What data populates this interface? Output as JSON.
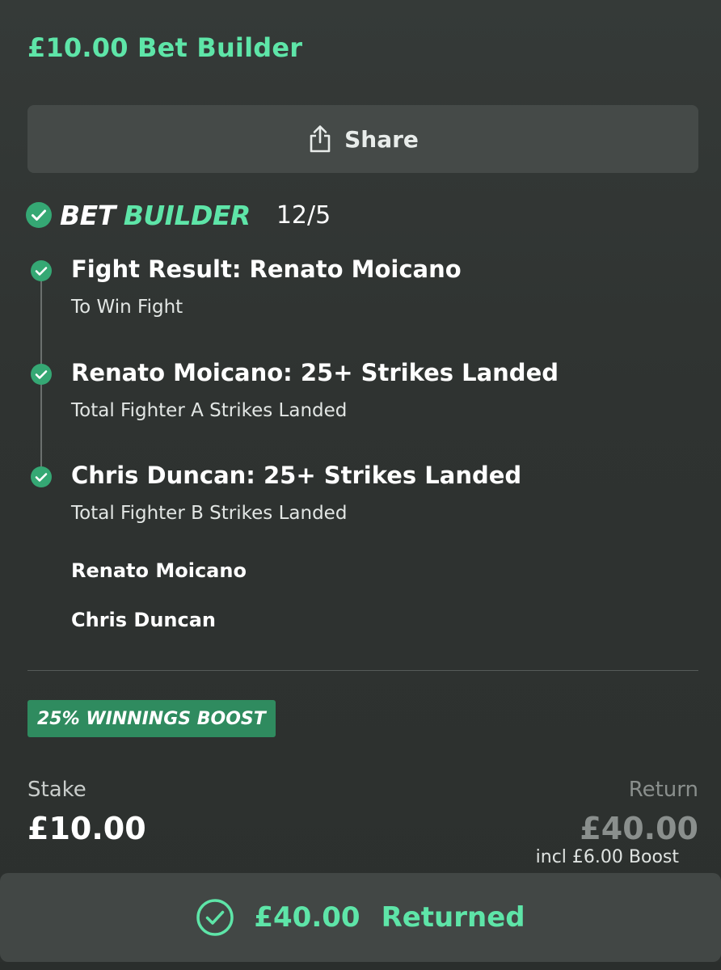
{
  "header": {
    "title": "£10.00 Bet Builder"
  },
  "share": {
    "label": "Share",
    "icon": "share-icon"
  },
  "bet_builder": {
    "word1": "BET",
    "word2": "BUILDER",
    "odds": "12/5",
    "status_icon": "check-circle-icon"
  },
  "selections": [
    {
      "title": "Fight Result: Renato Moicano",
      "subtitle": "To Win Fight"
    },
    {
      "title": "Renato Moicano: 25+ Strikes Landed",
      "subtitle": "Total Fighter A Strikes Landed"
    },
    {
      "title": "Chris Duncan: 25+ Strikes Landed",
      "subtitle": "Total Fighter B Strikes Landed"
    }
  ],
  "fighters": [
    "Renato Moicano",
    "Chris Duncan"
  ],
  "boost": {
    "badge": "25% WINNINGS BOOST"
  },
  "summary": {
    "stake_label": "Stake",
    "stake_value": "£10.00",
    "return_label": "Return",
    "return_value": "£40.00",
    "boost_note": "incl £6.00 Boost"
  },
  "footer": {
    "amount": "£40.00",
    "label": "Returned",
    "icon": "check-circle-icon"
  },
  "colors": {
    "accent": "#5ee5a8",
    "background": "#2f3331",
    "boost_badge": "#2f8b5f",
    "check": "#35a874"
  }
}
